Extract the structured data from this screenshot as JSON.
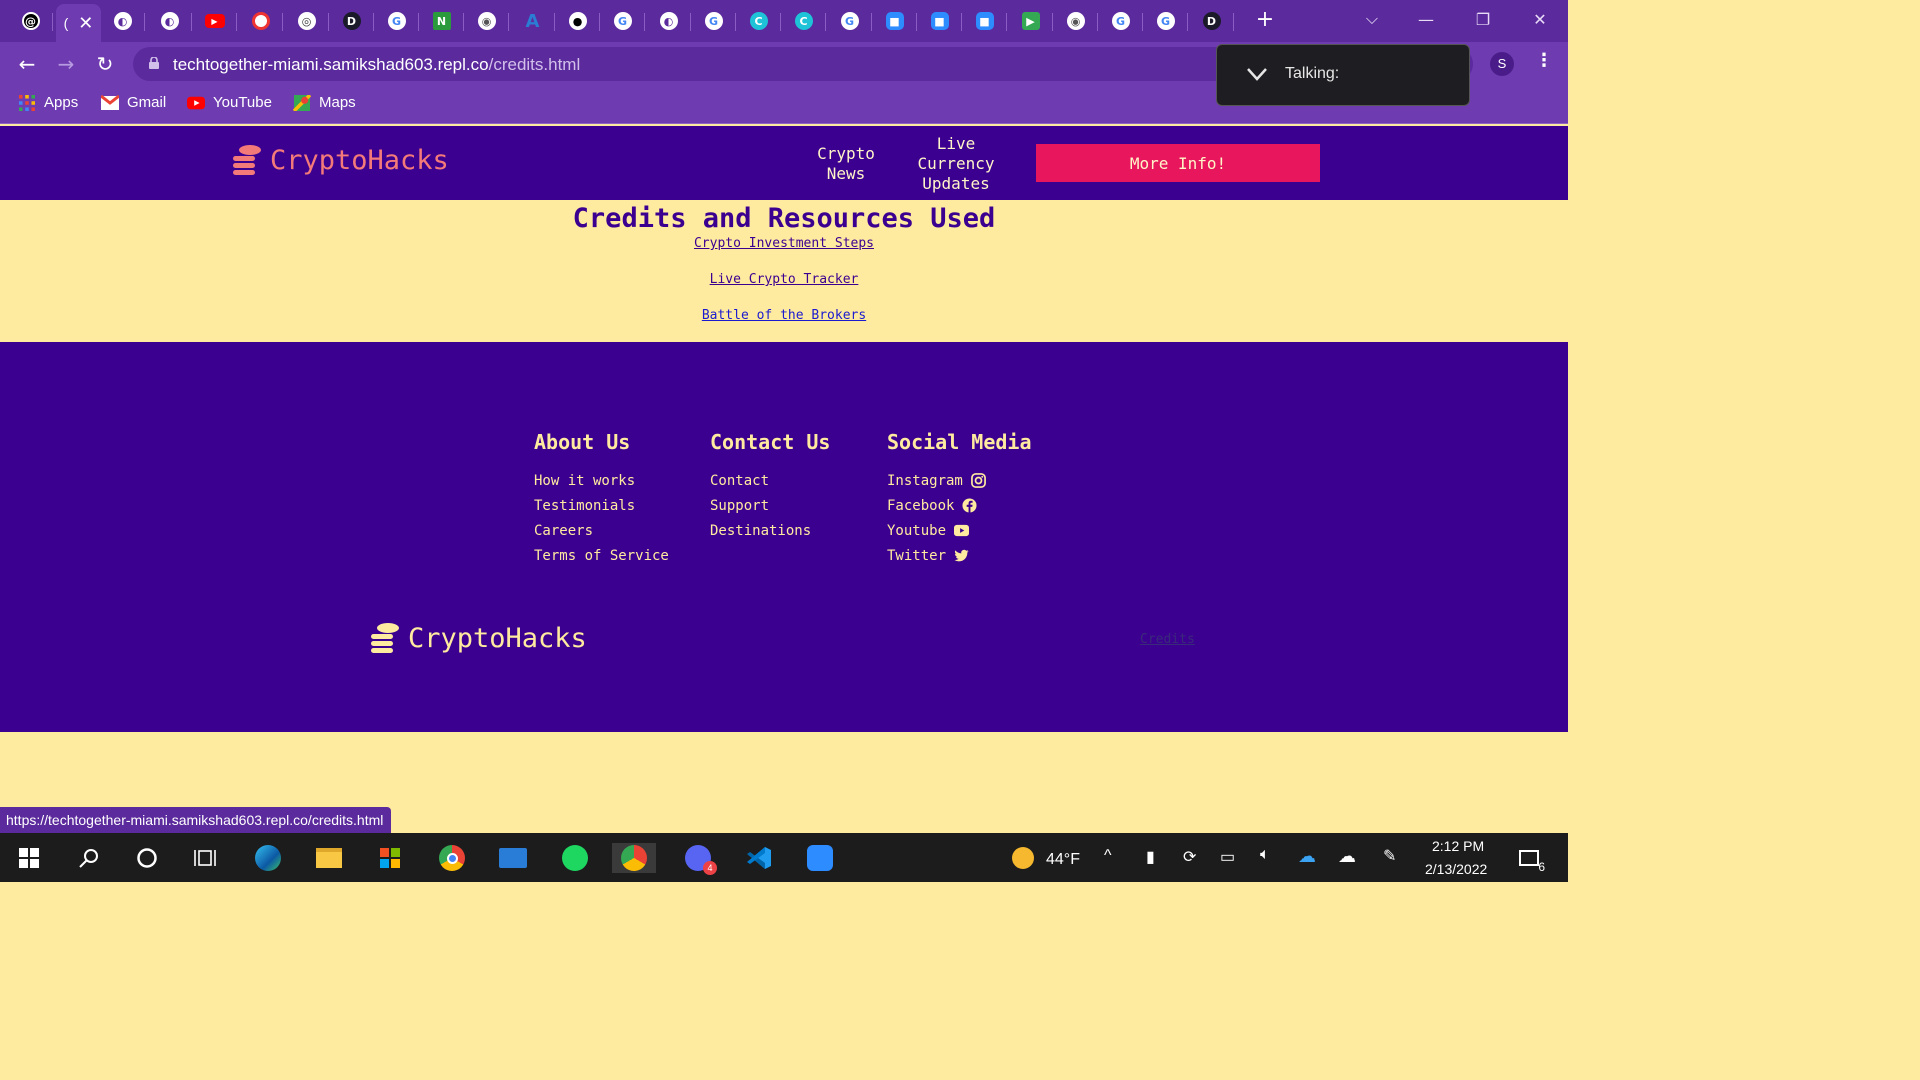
{
  "browser": {
    "url_host": "techtogether-miami.samikshad603.repl.co",
    "url_path": "/credits.html",
    "profile_initial": "S",
    "bookmarks": [
      {
        "label": "Apps",
        "icon": "apps-grid-icon"
      },
      {
        "label": "Gmail",
        "icon": "gmail-icon"
      },
      {
        "label": "YouTube",
        "icon": "youtube-icon"
      },
      {
        "label": "Maps",
        "icon": "maps-icon"
      }
    ],
    "status_url": "https://techtogether-miami.samikshad603.repl.co/credits.html",
    "talking_label": "Talking:",
    "active_tab_title": "("
  },
  "site": {
    "brand": "CryptoHacks",
    "nav": {
      "crypto_news_line1": "Crypto",
      "crypto_news_line2": "News",
      "live_line1": "Live",
      "live_line2": "Currency",
      "live_line3": "Updates",
      "more_info": "More Info!"
    },
    "credits": {
      "heading": "Credits and Resources Used",
      "links": [
        "Crypto Investment Steps",
        "Live Crypto Tracker",
        "Battle of the Brokers"
      ]
    },
    "footer": {
      "about": {
        "heading": "About Us",
        "items": [
          "How it works",
          "Testimonials",
          "Careers",
          "Terms of Service"
        ]
      },
      "contact": {
        "heading": "Contact Us",
        "items": [
          "Contact",
          "Support",
          "Destinations"
        ]
      },
      "social": {
        "heading": "Social Media",
        "items": [
          "Instagram",
          "Facebook",
          "Youtube",
          "Twitter"
        ]
      },
      "credits_link": "Credits"
    }
  },
  "taskbar": {
    "weather": "44°F",
    "time": "2:12 PM",
    "date": "2/13/2022",
    "notification_count": "6",
    "discord_badge": "4"
  },
  "colors": {
    "site_purple": "#3c0090",
    "cream": "#ffeba0",
    "accent_pink": "#e8175d",
    "chrome_purple": "#6e3cb0"
  }
}
